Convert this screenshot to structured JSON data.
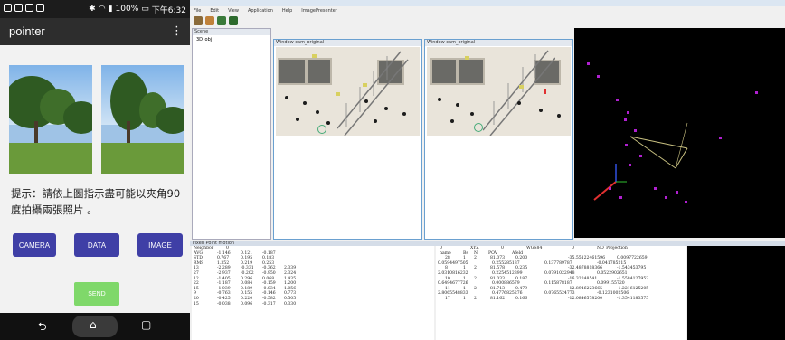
{
  "phone": {
    "status": {
      "battery": "100%",
      "time": "下午6:32"
    },
    "app_title": "pointer",
    "menu_icon": "more-vert-icon",
    "hint_text": "提示：請依上圖指示盡可能以夾角90度拍攝兩張照片 。",
    "buttons": {
      "camera": "CAMERA",
      "data": "DATA",
      "image": "IMAGE",
      "send": "SEND"
    },
    "nav": [
      "back-icon",
      "home-icon",
      "recents-icon"
    ]
  },
  "app": {
    "menu": [
      "File",
      "Edit",
      "View",
      "Application",
      "Help",
      "ImagePresenter"
    ],
    "scene_panel_title": "Scene",
    "scene_item": "3D_obj",
    "cam1_title": "Window cam_original",
    "cam2_title": "Window cam_original",
    "bottom_panel_title": "Fixed Point motion",
    "colors": {
      "accent": "#3f3fa6",
      "send": "#7fd86a",
      "magenta": "#b020d0"
    }
  },
  "table1": {
    "header": [
      "Neighbor",
      "0"
    ],
    "rows": [
      [
        "AVG",
        "-1.146",
        "0.121",
        "-0.187",
        ""
      ],
      [
        "STD",
        "0.767",
        "0.195",
        "0.183",
        ""
      ],
      [
        "RMS",
        "1.352",
        "0.219",
        "0.253",
        ""
      ],
      [
        "13",
        "-2.289",
        "-0.331",
        "-0.362",
        "2.339"
      ],
      [
        "27",
        "-2.937",
        "-0.202",
        "-0.950",
        "2.324"
      ],
      [
        "12",
        "-1.405",
        "0.296",
        "0.068",
        "1.435"
      ],
      [
        "22",
        "-1.187",
        "0.084",
        "-0.159",
        "1.200"
      ],
      [
        "15",
        "-1.039",
        "0.189",
        "-0.034",
        "1.056"
      ],
      [
        "9",
        "-0.763",
        "0.155",
        "-0.146",
        "0.773"
      ],
      [
        "20",
        "-0.425",
        "0.220",
        "-0.582",
        "0.505"
      ],
      [
        "15",
        "-0.038",
        "0.096",
        "-0.317",
        "0.330"
      ]
    ]
  },
  "table2": {
    "header": [
      "0",
      "XYZ",
      "0",
      "WGS84",
      "0",
      "NO_Projection"
    ],
    "subheader": [
      "name",
      "Bs",
      "N",
      "POV",
      "Afeld"
    ],
    "rows": [
      [
        "28",
        "1",
        "2",
        "81.073",
        "0.200",
        "-35.55122461596",
        "0.0097722659"
      ],
      [
        "0.0594497505",
        "",
        "",
        "0.255285137",
        "0.137789787",
        "-0.041785215",
        ""
      ],
      [
        "8",
        "1",
        "2",
        "81.578",
        "0.235",
        "-32.4878818366",
        "-1.543453795"
      ],
      [
        "2.0310816232",
        "",
        "",
        "0.2254512399",
        "0.0791022948",
        "0.0522902651",
        ""
      ],
      [
        "10",
        "1",
        "2",
        "81.033",
        "0.187",
        "-16.32248541",
        "-1.5584127952"
      ],
      [
        "0.6494677726",
        "",
        "",
        "0.000886579",
        "0.115878187",
        "0.099155720",
        ""
      ],
      [
        "11",
        "1",
        "2",
        "81.713",
        "0.479",
        "-12.8946223665",
        "-1.2216125205"
      ],
      [
        "2.8065548833",
        "",
        "",
        "0.4776825276",
        "0.0765524773",
        "-0.1231002506",
        ""
      ],
      [
        "17",
        "1",
        "2",
        "81.162",
        "0.166",
        "-12.0846578200",
        "-1.3541183575"
      ]
    ]
  }
}
